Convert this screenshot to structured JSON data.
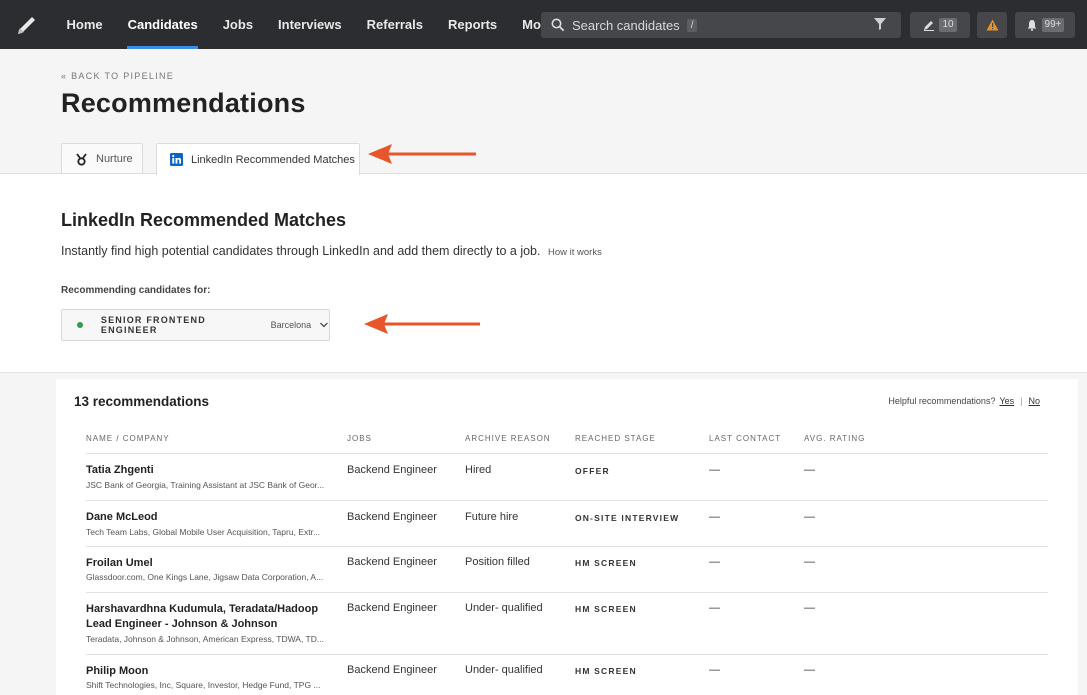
{
  "nav": {
    "items": [
      {
        "label": "Home",
        "active": false
      },
      {
        "label": "Candidates",
        "active": true
      },
      {
        "label": "Jobs",
        "active": false
      },
      {
        "label": "Interviews",
        "active": false
      },
      {
        "label": "Referrals",
        "active": false
      },
      {
        "label": "Reports",
        "active": false
      },
      {
        "label": "More",
        "active": false
      }
    ],
    "search_placeholder": "Search candidates",
    "search_shortcut": "/",
    "edit_count": "10",
    "notifications_count": "99+",
    "icons": [
      "logo-icon",
      "search-icon",
      "filter-icon",
      "edit-icon",
      "warning-icon",
      "bell-icon"
    ]
  },
  "header": {
    "back_link": "« BACK TO PIPELINE",
    "title": "Recommendations"
  },
  "tabs": [
    {
      "label": "Nurture",
      "icon": "nurture-icon",
      "active": false
    },
    {
      "label": "LinkedIn Recommended Matches",
      "icon": "linkedin-icon",
      "active": true
    }
  ],
  "section": {
    "title": "LinkedIn Recommended Matches",
    "description": "Instantly find high potential candidates through LinkedIn and add them directly to a job.",
    "how_link": "How it works",
    "recommending_label": "Recommending candidates for:",
    "job_select": {
      "job": "SENIOR FRONTEND ENGINEER",
      "location": "Barcelona",
      "status_color": "#2e9e4c"
    }
  },
  "table": {
    "count_label": "13 recommendations",
    "helpful": {
      "prompt": "Helpful recommendations?",
      "yes": "Yes",
      "separator": "|",
      "no": "No"
    },
    "columns": [
      "NAME / COMPANY",
      "JOBS",
      "ARCHIVE REASON",
      "REACHED STAGE",
      "LAST CONTACT",
      "AVG. RATING"
    ],
    "rows": [
      {
        "name": "Tatia Zhgenti",
        "company": "JSC Bank of Georgia, Training Assistant at JSC Bank of Geor...",
        "job": "Backend Engineer",
        "reason": "Hired",
        "stage": "OFFER",
        "last_contact": "—",
        "rating": "—"
      },
      {
        "name": "Dane McLeod",
        "company": "Tech Team Labs, Global Mobile User Acquisition, Tapru, Extr...",
        "job": "Backend Engineer",
        "reason": "Future hire",
        "stage": "ON-SITE INTERVIEW",
        "last_contact": "—",
        "rating": "—"
      },
      {
        "name": "Froilan Umel",
        "company": "Glassdoor.com, One Kings Lane, Jigsaw Data Corporation, A...",
        "job": "Backend Engineer",
        "reason": "Position filled",
        "stage": "HM SCREEN",
        "last_contact": "—",
        "rating": "—"
      },
      {
        "name": "Harshavardhna Kudumula, Teradata/Hadoop Lead Engineer - Johnson & Johnson",
        "company": "Teradata, Johnson & Johnson, American Express, TDWA, TD...",
        "job": "Backend Engineer",
        "reason": "Under- qualified",
        "stage": "HM SCREEN",
        "last_contact": "—",
        "rating": "—"
      },
      {
        "name": "Philip Moon",
        "company": "Shift Technologies, Inc, Square, Investor, Hedge Fund, TPG ...",
        "job": "Backend Engineer",
        "reason": "Under- qualified",
        "stage": "HM SCREEN",
        "last_contact": "—",
        "rating": "—"
      }
    ]
  },
  "colors": {
    "nav_bg": "#2c2d30",
    "accent": "#3b8ee4",
    "annotation_arrow": "#e8552b",
    "linkedin": "#0a66c2",
    "warning": "#e8912b"
  }
}
